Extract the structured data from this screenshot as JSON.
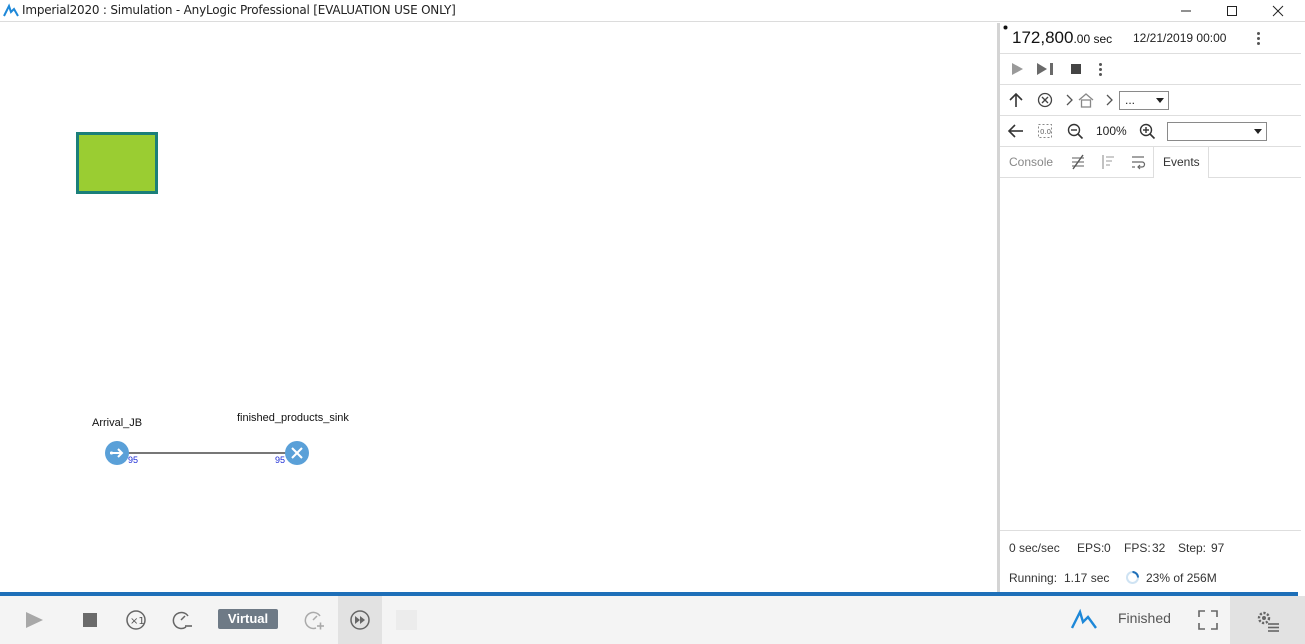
{
  "window": {
    "title": "Imperial2020 : Simulation - AnyLogic Professional [EVALUATION USE ONLY]"
  },
  "canvas": {
    "nodes": [
      {
        "label": "Arrival_JB",
        "count": "95",
        "type": "source"
      },
      {
        "label": "finished_products_sink",
        "count": "95",
        "type": "sink"
      }
    ]
  },
  "panel": {
    "time_value": "172,800",
    "time_unit": ".00 sec",
    "datetime": "12/21/2019 00:00",
    "nav_dropdown": "...",
    "zoom": "100%",
    "zoom_dropdown": "",
    "tabs": [
      {
        "label": "Console",
        "active": false
      },
      {
        "label": "Events",
        "active": true
      }
    ],
    "stats": {
      "speed": "0 sec/sec",
      "eps_label": "EPS:",
      "eps": "0",
      "fps_label": "FPS:",
      "fps": "32",
      "step_label": "Step:",
      "step": "97",
      "running_label": "Running:",
      "running": "1.17 sec",
      "memory": "23% of 256M"
    }
  },
  "toolbar": {
    "mode_label": "Virtual",
    "status": "Finished"
  },
  "colors": {
    "accent_blue": "#1e6fb8",
    "node_blue": "#5aa0d8",
    "box_fill": "#9acd32",
    "box_border": "#1b7f79"
  }
}
